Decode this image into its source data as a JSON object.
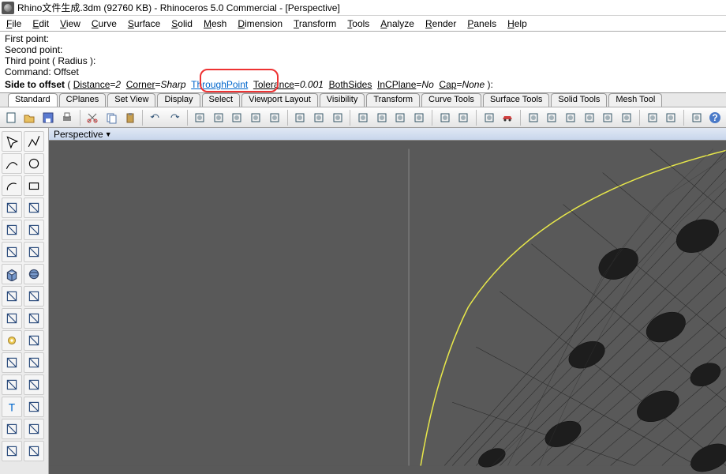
{
  "title": "Rhino文件生成.3dm (92760 KB) - Rhinoceros 5.0 Commercial - [Perspective]",
  "menubar": [
    "File",
    "Edit",
    "View",
    "Curve",
    "Surface",
    "Solid",
    "Mesh",
    "Dimension",
    "Transform",
    "Tools",
    "Analyze",
    "Render",
    "Panels",
    "Help"
  ],
  "cmdhist": [
    "First point:",
    "Second point:",
    "Third point ( Radius ):",
    "Command: Offset"
  ],
  "cmd": {
    "prompt": "Side to offset",
    "dist_label": "Distance",
    "dist_val": "2",
    "corner_label": "Corner",
    "corner_val": "Sharp",
    "through_label": "ThroughPoint",
    "tol_label": "Tolerance",
    "tol_val": "0.001",
    "both_label": "BothSides",
    "incp_label": "InCPlane",
    "incp_val": "No",
    "cap_label": "Cap",
    "cap_val": "None"
  },
  "tabs": [
    "Standard",
    "CPlanes",
    "Set View",
    "Display",
    "Select",
    "Viewport Layout",
    "Visibility",
    "Transform",
    "Curve Tools",
    "Surface Tools",
    "Solid Tools",
    "Mesh Tool"
  ],
  "active_tab": 0,
  "toolbar_icons": [
    "new",
    "open",
    "save",
    "print",
    "sep",
    "cut",
    "copy",
    "paste",
    "sep",
    "undo",
    "redo",
    "sep",
    "pan",
    "rotate",
    "zoom-extents",
    "zoom-window",
    "zoom-selected",
    "sep",
    "wireframe",
    "shaded",
    "rendered",
    "sep",
    "show",
    "hide",
    "lock",
    "unlock",
    "sep",
    "layers",
    "properties",
    "sep",
    "options",
    "car",
    "sep",
    "box",
    "sphere",
    "cylinder",
    "cone",
    "torus",
    "plane",
    "sep",
    "render",
    "animate",
    "sep",
    "layout",
    "help"
  ],
  "side_icons": [
    "arrow",
    "polyline",
    "curve",
    "circle",
    "arc",
    "rect",
    "curve2",
    "polygon",
    "move",
    "rotate-tool",
    "scale",
    "mirror",
    "box3d",
    "sphere3d",
    "cyl3d",
    "revolve",
    "loft",
    "sweep",
    "gear",
    "explode",
    "trim",
    "join",
    "fillet",
    "chamfer",
    "text",
    "dim",
    "pipe",
    "offset",
    "hatch",
    "wire"
  ],
  "vplabel": "Perspective"
}
